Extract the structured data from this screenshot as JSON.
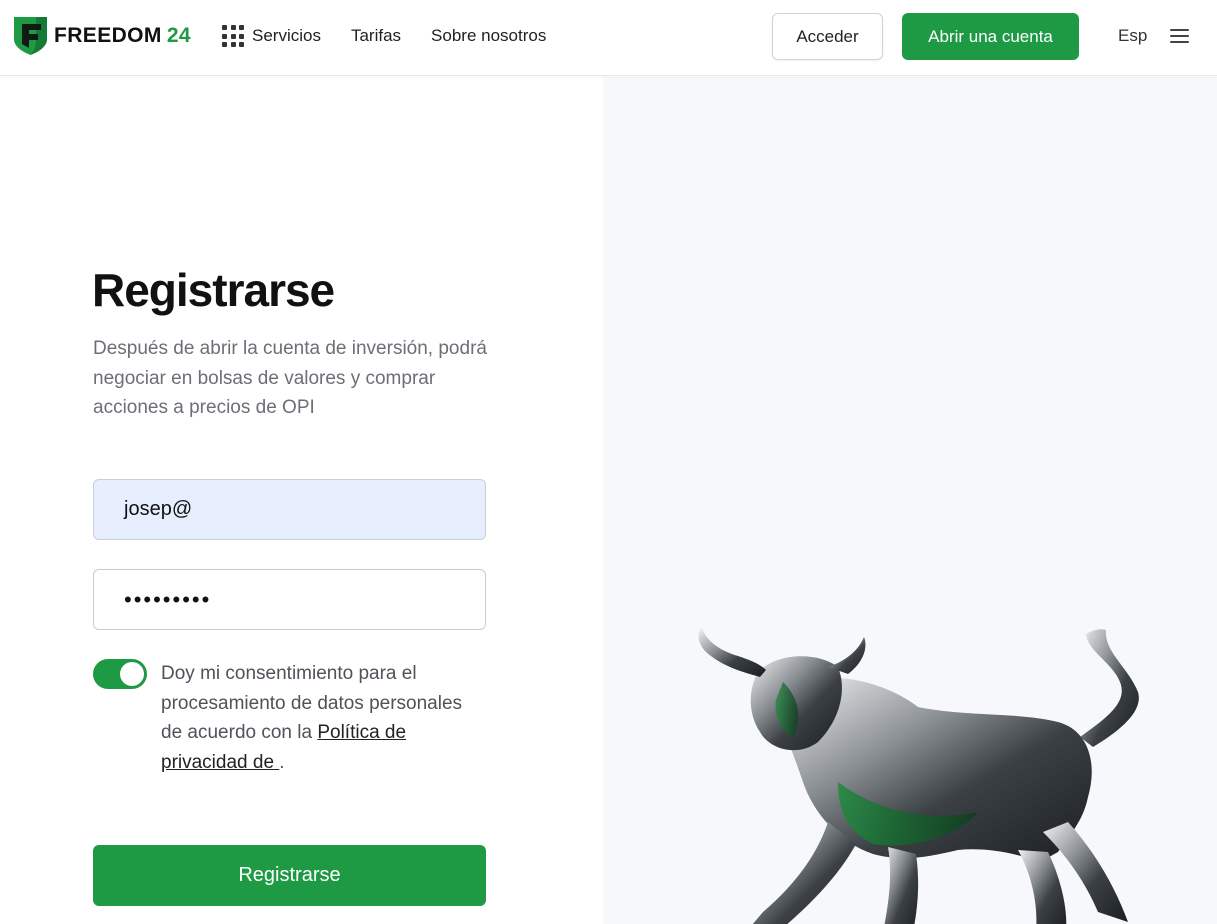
{
  "header": {
    "logo": {
      "brand": "FREEDOM",
      "number": "24"
    },
    "nav": [
      {
        "label": "Servicios",
        "icon": "grid-icon"
      },
      {
        "label": "Tarifas"
      },
      {
        "label": "Sobre nosotros"
      }
    ],
    "login_label": "Acceder",
    "open_account_label": "Abrir una cuenta",
    "language": "Esp",
    "menu_icon": "hamburger-menu-icon"
  },
  "form": {
    "title": "Registrarse",
    "subtitle": "Después de abrir la cuenta de inversión, podrá negociar en bolsas de valores y comprar acciones a precios de OPI",
    "email_value": "josep@",
    "password_value": "•••••••••",
    "consent_toggle_on": true,
    "consent_text": "Doy mi consentimiento para el procesamiento de datos personales de acuerdo con la",
    "privacy_link": "Política de privacidad de ",
    "consent_end": ".",
    "submit_label": "Registrarse"
  },
  "colors": {
    "brand_green": "#1e9a44",
    "email_field_bg": "#e7efff",
    "right_panel_bg": "#f6f8fb"
  },
  "illustration": "bull-illustration"
}
